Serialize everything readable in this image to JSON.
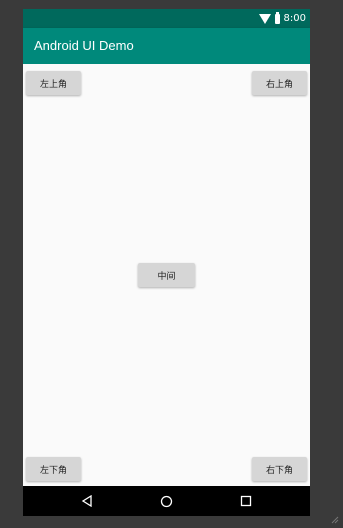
{
  "status_bar": {
    "time": "8:00",
    "icons": [
      "wifi-icon",
      "battery-icon"
    ],
    "color": "#00695c"
  },
  "app_bar": {
    "title": "Android UI Demo",
    "color": "#00897b"
  },
  "buttons": {
    "top_left": "左上角",
    "top_right": "右上角",
    "center": "中间",
    "bottom_left": "左下角",
    "bottom_right": "右下角"
  },
  "nav_bar": {
    "items": [
      "back-icon",
      "home-icon",
      "recents-icon"
    ]
  }
}
